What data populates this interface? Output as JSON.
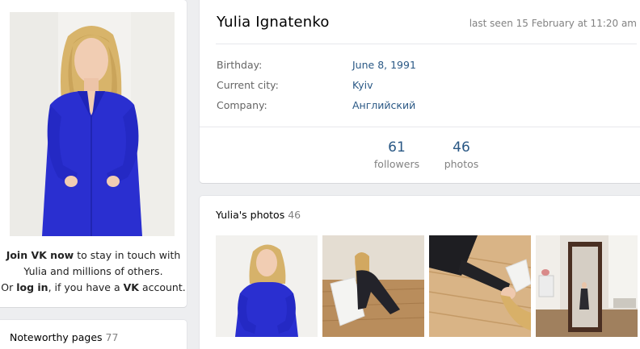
{
  "left": {
    "join_prefix": "Join VK now",
    "join_text1": " to stay in touch with",
    "join_text2": "Yulia and millions of others.",
    "join_or": "Or ",
    "log_in": "log in",
    "join_mid": ", if you have a ",
    "vk": "VK",
    "join_suffix": " account."
  },
  "noteworthy": {
    "label": "Noteworthy pages",
    "count": "77"
  },
  "profile": {
    "name": "Yulia Ignatenko",
    "last_seen": "last seen 15 February at 11:20 am",
    "info": [
      {
        "label": "Birthday:",
        "value": "June 8, 1991"
      },
      {
        "label": "Current city:",
        "value": "Kyiv"
      },
      {
        "label": "Company:",
        "value": "Английский"
      }
    ],
    "stats": [
      {
        "count": "61",
        "label": "followers"
      },
      {
        "count": "46",
        "label": "photos"
      }
    ]
  },
  "photos": {
    "title": "Yulia's photos",
    "count": "46"
  },
  "colors": {
    "link": "#2a5885",
    "muted": "#828282",
    "page_bg": "#edeef0",
    "shirt_blue": "#2a2fd0"
  }
}
